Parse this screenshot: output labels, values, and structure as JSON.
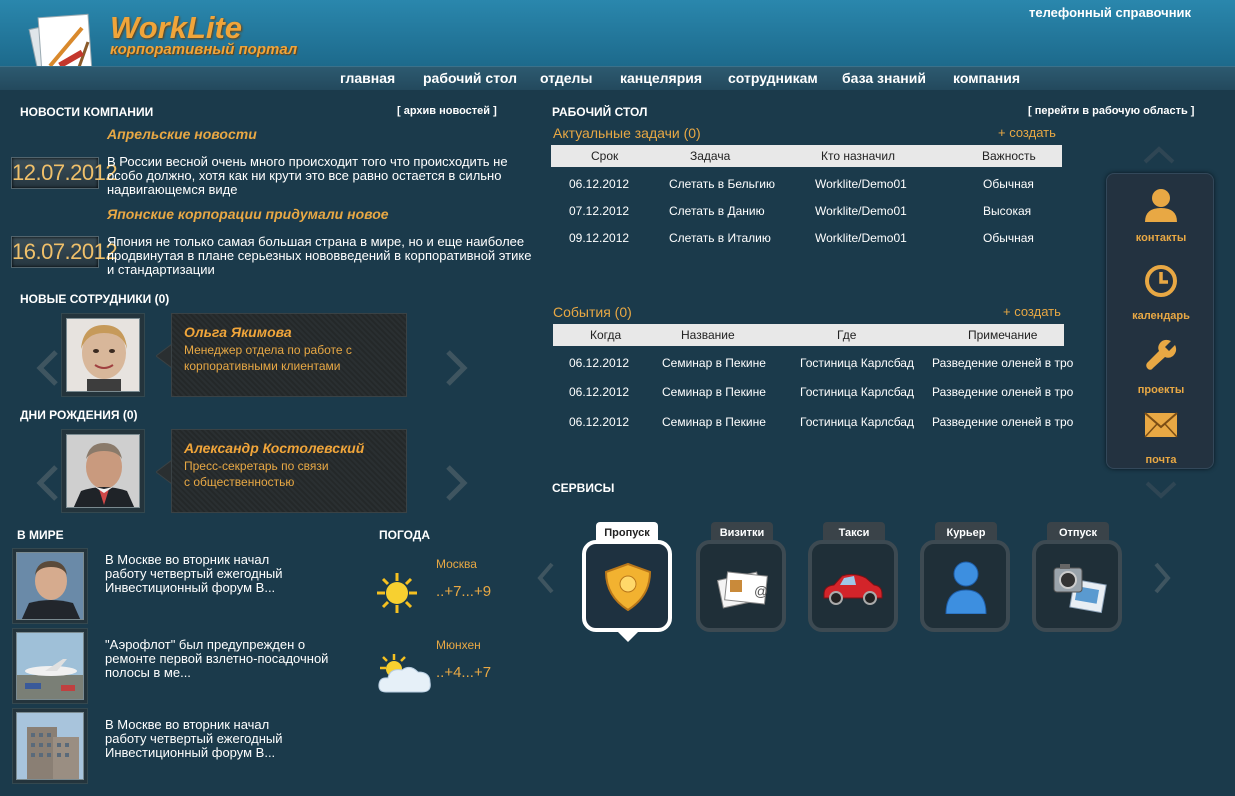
{
  "header": {
    "logo_title": "WorkLite",
    "logo_subtitle": "корпоративный портал",
    "phonebook_link": "телефонный справочник"
  },
  "nav": {
    "items": [
      "главная",
      "рабочий стол",
      "отделы",
      "канцелярия",
      "сотрудникам",
      "база знаний",
      "компания"
    ]
  },
  "news": {
    "title": "НОВОСТИ КОМПАНИИ",
    "archive_link": "[ архив новостей ]",
    "items": [
      {
        "date": "12.07.2012",
        "headline": "Апрельские новости",
        "text": "В России весной очень много происходит того что происходить не особо должно, хотя как ни крути это все равно остается в сильно надвигающемся виде"
      },
      {
        "date": "16.07.2012",
        "headline": "Японские корпорации придумали новое",
        "text": "Япония не только самая большая страна в мире, но и еще наиболее продвинутая в плане серьезных нововведений в корпоративной этике и стандартизации"
      }
    ]
  },
  "new_employees": {
    "title": "НОВЫЕ СОТРУДНИКИ (0)",
    "name": "Ольга Якимова",
    "position": "Менеджер отдела по работе с корпоративными клиентами"
  },
  "birthdays": {
    "title": "ДНИ РОЖДЕНИЯ (0)",
    "name": "Александр Костолевский",
    "position": "Пресс-секретарь по связи с общественностью"
  },
  "world": {
    "title": "В МИРЕ",
    "items": [
      "В Москве во вторник начал работу четвертый ежегодный Инвестиционный форум В...",
      "\"Аэрофлот\" был предупрежден о ремонте первой взлетно-посадочной полосы в ме...",
      "В Москве во вторник начал работу четвертый ежегодный Инвестиционный форум В..."
    ]
  },
  "weather": {
    "title": "ПОГОДА",
    "items": [
      {
        "city": "Москва",
        "temp": "..+7...+9",
        "icon": "sun-icon"
      },
      {
        "city": "Мюнхен",
        "temp": "..+4...+7",
        "icon": "cloud-sun-icon"
      }
    ]
  },
  "desktop": {
    "title": "РАБОЧИЙ СТОЛ",
    "workspace_link": "[ перейти в рабочую область ]"
  },
  "tasks": {
    "title": "Актуальные задачи (0)",
    "create": "+ создать",
    "columns": [
      "Срок",
      "Задача",
      "Кто назначил",
      "Важность"
    ],
    "rows": [
      [
        "06.12.2012",
        "Слетать в Бельгию",
        "Worklite/Demo01",
        "Обычная"
      ],
      [
        "07.12.2012",
        "Слетать в Данию",
        "Worklite/Demo01",
        "Высокая"
      ],
      [
        "09.12.2012",
        "Слетать в Италию",
        "Worklite/Demo01",
        "Обычная"
      ]
    ]
  },
  "events": {
    "title": "События (0)",
    "create": "+ создать",
    "columns": [
      "Когда",
      "Название",
      "Где",
      "Примечание"
    ],
    "rows": [
      [
        "06.12.2012",
        "Семинар в Пекине",
        "Гостиница Карлсбад",
        "Разведение оленей в тро"
      ],
      [
        "06.12.2012",
        "Семинар в Пекине",
        "Гостиница Карлсбад",
        "Разведение оленей в тро"
      ],
      [
        "06.12.2012",
        "Семинар в Пекине",
        "Гостиница Карлсбад",
        "Разведение оленей в тро"
      ]
    ]
  },
  "sidebar": {
    "items": [
      {
        "label": "контакты",
        "icon": "person-icon"
      },
      {
        "label": "календарь",
        "icon": "clock-icon"
      },
      {
        "label": "проекты",
        "icon": "wrench-icon"
      },
      {
        "label": "почта",
        "icon": "envelope-icon"
      }
    ]
  },
  "services": {
    "title": "СЕРВИСЫ",
    "items": [
      {
        "label": "Пропуск",
        "icon": "shield-badge-icon",
        "active": true
      },
      {
        "label": "Визитки",
        "icon": "business-cards-icon",
        "active": false
      },
      {
        "label": "Такси",
        "icon": "car-icon",
        "active": false
      },
      {
        "label": "Курьер",
        "icon": "courier-person-icon",
        "active": false
      },
      {
        "label": "Отпуск",
        "icon": "camera-icon",
        "active": false
      }
    ]
  },
  "colors": {
    "accent": "#e8a844",
    "background": "#1b3a4b",
    "header": "#2a87ad"
  }
}
